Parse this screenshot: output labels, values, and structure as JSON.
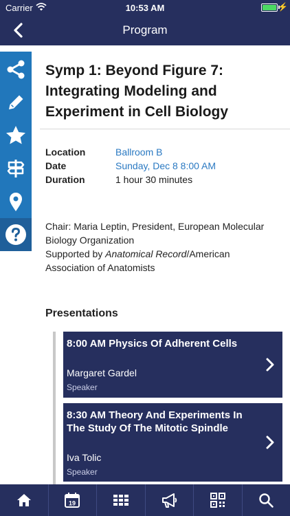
{
  "status_bar": {
    "carrier": "Carrier",
    "time": "10:53 AM"
  },
  "nav": {
    "title": "Program"
  },
  "side_toolbar": [
    "share-icon",
    "pencil-icon",
    "star-icon",
    "signpost-icon",
    "location-pin-icon",
    "help-icon"
  ],
  "session": {
    "title": "Symp 1: Beyond Figure 7: Integrating Modeling and Experiment in Cell Biology",
    "location_label": "Location",
    "location_value": "Ballroom B",
    "date_label": "Date",
    "date_value": "Sunday, Dec 8 8:00 AM",
    "duration_label": "Duration",
    "duration_value": "1 hour 30 minutes",
    "chair": "Chair: Maria Leptin, President, European Molecular Biology Organization",
    "supported_prefix": "Supported by ",
    "supported_italic": "Anatomical Record",
    "supported_suffix": "/American Association of Anatomists"
  },
  "presentations": {
    "heading": "Presentations",
    "items": [
      {
        "title": "8:00 AM  Physics Of Adherent Cells",
        "speaker": "Margaret Gardel",
        "role": "Speaker"
      },
      {
        "title": "8:30 AM  Theory And Experiments In The Study Of The Mitotic Spindle",
        "speaker": "Iva Tolic",
        "role": "Speaker"
      }
    ]
  },
  "tab_bar": {
    "tabs": [
      "home-icon",
      "calendar-icon",
      "grid-icon",
      "megaphone-icon",
      "qr-code-icon",
      "search-icon"
    ],
    "calendar_day": "19"
  },
  "colors": {
    "navy": "#262f5e",
    "side_blue": "#2177bb",
    "link_blue": "#2a79c2"
  }
}
